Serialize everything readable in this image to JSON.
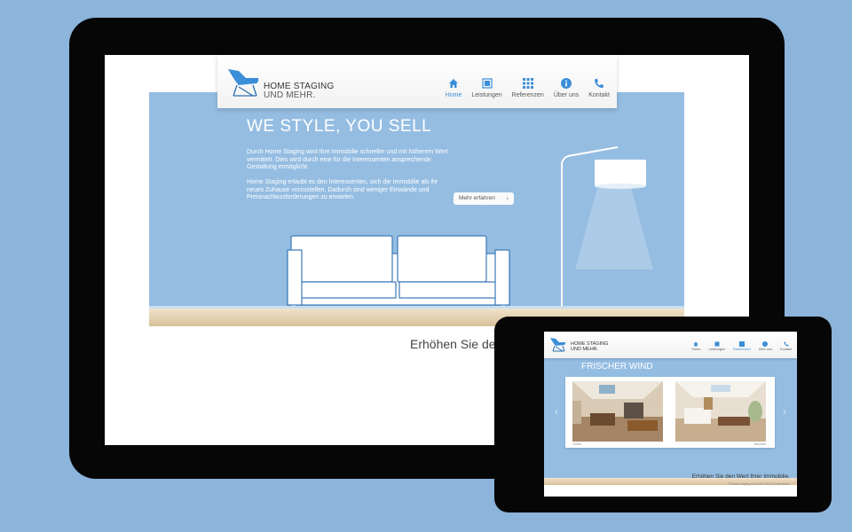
{
  "desktop_site": {
    "brand": {
      "line1": "HOME STAGING",
      "line2": "UND MEHR."
    },
    "nav": [
      {
        "label": "Home",
        "icon": "home-icon",
        "active": true
      },
      {
        "label": "Leistungen",
        "icon": "services-icon",
        "active": false
      },
      {
        "label": "Referenzen",
        "icon": "grid-icon",
        "active": false
      },
      {
        "label": "Über uns",
        "icon": "info-icon",
        "active": false
      },
      {
        "label": "Kontakt",
        "icon": "phone-icon",
        "active": false
      }
    ],
    "tagline": "WE STYLE, YOU SELL",
    "paragraph1": "Durch Home Staging wird Ihre Immobilie schneller und mit höherem Wert vermittelt. Dies wird durch eine für die Interessenten ansprechende Gestaltung ermöglicht.",
    "paragraph2": "Home Staging erlaubt es den Interessenten, sich die Immobilie als ihr neues Zuhause vorzustellen. Dadurch sind weniger Einwände und Preisnachlassforderungen zu erwarten.",
    "more_button": "Mehr erfahren",
    "bottom_text": "Erhöhen Sie de"
  },
  "tablet_site": {
    "brand": {
      "line1": "HOME STAGING",
      "line2": "UND MEHR."
    },
    "nav": [
      {
        "label": "Home"
      },
      {
        "label": "Leistungen"
      },
      {
        "label": "Referenzen"
      },
      {
        "label": "Über uns"
      },
      {
        "label": "Kontakt"
      }
    ],
    "section_title": "FRISCHER WIND",
    "captions": [
      "Vorher",
      "Nachher"
    ],
    "bottom_text": "Erhöhen Sie den Wert Ihrer Immobilie.",
    "copyright": "© home staging und mehr 2013 | Impressum"
  },
  "colors": {
    "background": "#8db4da",
    "wall": "#95bde2",
    "accent": "#3b8ed8",
    "device": "#060606"
  }
}
